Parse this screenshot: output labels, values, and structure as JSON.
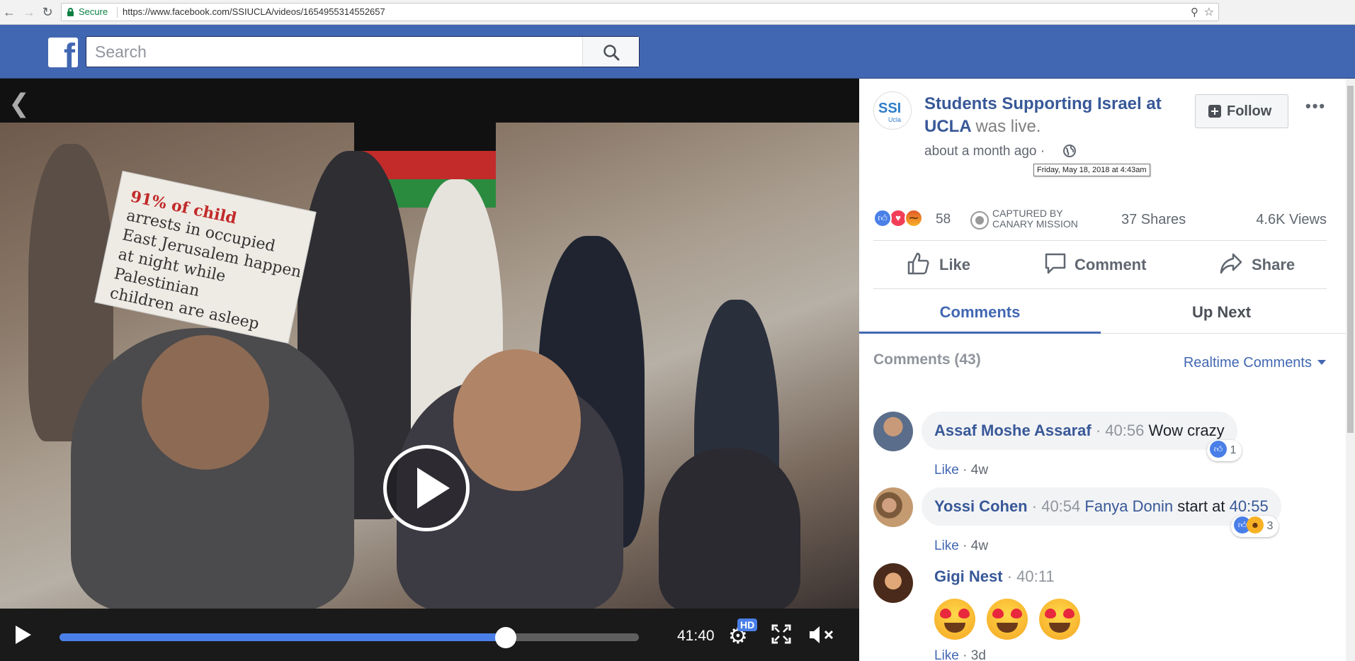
{
  "browser": {
    "secure_label": "Secure",
    "url": "https://www.facebook.com/SSIUCLA/videos/1654955314552657"
  },
  "header": {
    "logo_letter": "f",
    "search_placeholder": "Search"
  },
  "video": {
    "sign_lines": [
      "91% of child",
      "arrests in occupied",
      "East Jerusalem happen",
      "at night while Palestinian",
      "children are asleep"
    ],
    "timecode": "41:40",
    "progress": 0.77,
    "hd_label": "HD"
  },
  "post": {
    "page_name": "Students Supporting Israel at UCLA",
    "status": "was live.",
    "posted_time": "about a month ago",
    "separator": "·",
    "tooltip": "Friday, May 18, 2018 at 4:43am",
    "follow_label": "Follow",
    "more_label": "•••",
    "avatar_text": "SSI",
    "avatar_sub": "Ucla",
    "reaction_count": "58",
    "captured_line1": "CAPTURED BY",
    "captured_line2": "CANARY MISSION",
    "shares": "37 Shares",
    "views": "4.6K Views",
    "actions": {
      "like": "Like",
      "comment": "Comment",
      "share": "Share"
    }
  },
  "tabs": [
    {
      "label": "Comments",
      "active": true
    },
    {
      "label": "Up Next",
      "active": false
    }
  ],
  "comments_section": {
    "header": "Comments (43)",
    "sort_label": "Realtime Comments"
  },
  "comments": [
    {
      "name": "Assaf Moshe Assaraf",
      "time": "40:56",
      "text": "Wow crazy",
      "like": "Like",
      "age": "4w",
      "reaction_count": "1"
    },
    {
      "name": "Yossi Cohen",
      "time": "40:54",
      "mention": "Fanya Donin",
      "text": "start at",
      "time_link": "40:55",
      "like": "Like",
      "age": "4w",
      "reaction_count": "3"
    },
    {
      "name": "Gigi Nest",
      "time": "40:11",
      "like": "Like",
      "age": "3d"
    }
  ]
}
